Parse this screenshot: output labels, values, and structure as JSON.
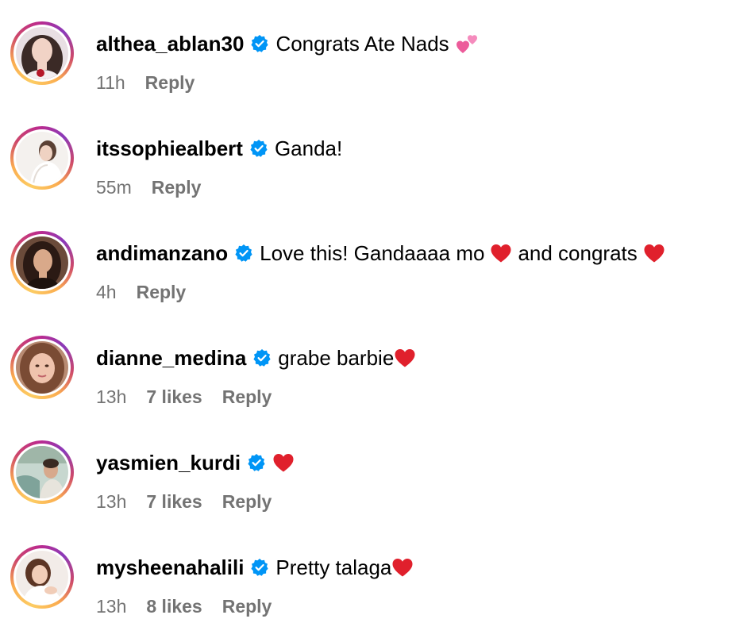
{
  "comments": [
    {
      "username": "althea_ablan30",
      "text": "Congrats Ate Nads",
      "emoji": "two-hearts",
      "time": "11h",
      "likes": "",
      "reply": "Reply"
    },
    {
      "username": "itssophiealbert",
      "text": "Ganda!",
      "emoji": "",
      "time": "55m",
      "likes": "",
      "reply": "Reply"
    },
    {
      "username": "andimanzano",
      "text_parts": [
        "Love this! Gandaaaa mo",
        "and congrats"
      ],
      "emoji": "red-heart",
      "time": "4h",
      "likes": "",
      "reply": "Reply"
    },
    {
      "username": "dianne_medina",
      "text": "grabe barbie",
      "emoji": "red-heart",
      "time": "13h",
      "likes": "7 likes",
      "reply": "Reply"
    },
    {
      "username": "yasmien_kurdi",
      "text": "",
      "emoji": "red-heart",
      "time": "13h",
      "likes": "7 likes",
      "reply": "Reply"
    },
    {
      "username": "mysheenahalili",
      "text": "Pretty talaga",
      "emoji": "red-heart",
      "time": "13h",
      "likes": "8 likes",
      "reply": "Reply"
    }
  ],
  "colors": {
    "verified": "#0095f6",
    "meta": "#737373",
    "heart": "#e0202c",
    "pink_hearts": "#f26ca7"
  }
}
